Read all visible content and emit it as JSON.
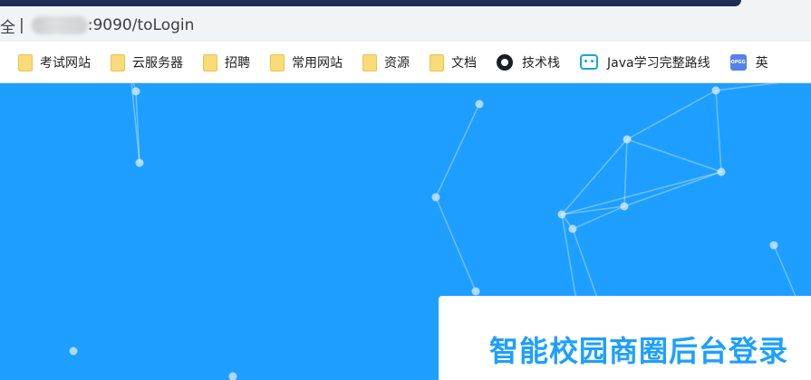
{
  "browser": {
    "address_prefix": "全",
    "address_separator": "|",
    "url_suffix": ":9090/toLogin"
  },
  "bookmarks": [
    {
      "label": "考试网站",
      "icon": "folder-icon"
    },
    {
      "label": "云服务器",
      "icon": "folder-icon"
    },
    {
      "label": "招聘",
      "icon": "folder-icon"
    },
    {
      "label": "常用网站",
      "icon": "folder-icon"
    },
    {
      "label": "资源",
      "icon": "folder-icon"
    },
    {
      "label": "文档",
      "icon": "folder-icon"
    },
    {
      "label": "技术栈",
      "icon": "github-icon"
    },
    {
      "label": "Java学习完整路线",
      "icon": "bilibili-icon"
    },
    {
      "label": "英",
      "icon": "opgg-icon"
    }
  ],
  "login": {
    "title": "智能校园商圈后台登录"
  },
  "colors": {
    "background": "#1e9fff",
    "title": "#1e9fff",
    "tab_dark": "#1e2d55"
  }
}
